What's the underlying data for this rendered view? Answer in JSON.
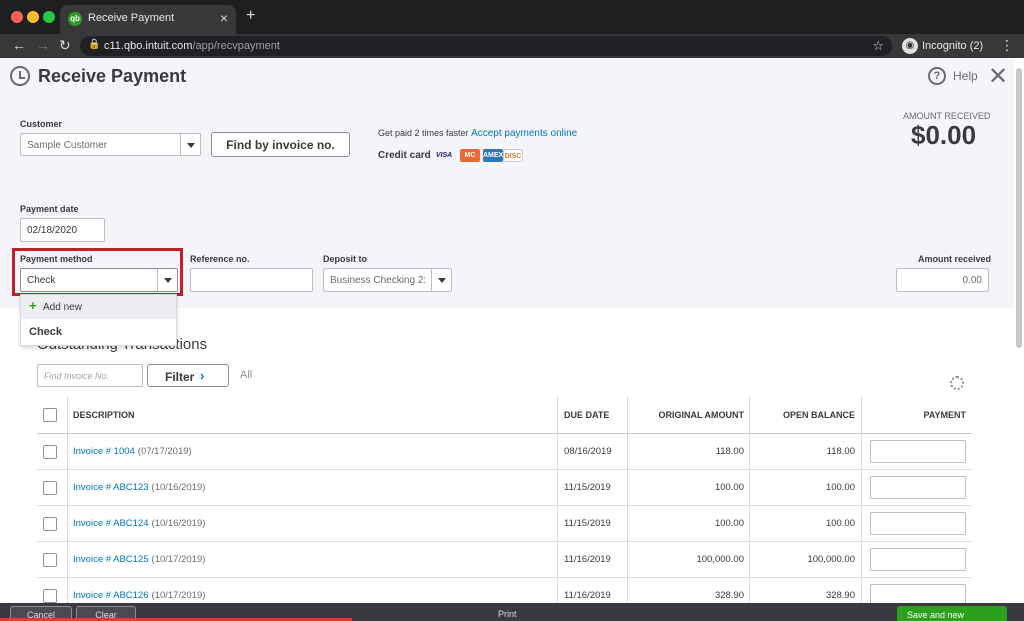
{
  "browser": {
    "tab_title": "Receive Payment",
    "tab_favicon": "qb",
    "url_host": "c11.qbo.intuit.com",
    "url_path": "/app/recvpayment",
    "profile_label": "Incognito (2)"
  },
  "header": {
    "title": "Receive Payment",
    "help_label": "Help"
  },
  "customer": {
    "label": "Customer",
    "value": "Sample Customer",
    "find_button": "Find by invoice no."
  },
  "promo": {
    "text": "Get paid 2 times faster",
    "link": "Accept payments online",
    "credit_card_label": "Credit card",
    "cards": [
      "VISA",
      "MC",
      "AMEX",
      "DISC"
    ]
  },
  "amount_received_summary": {
    "label": "AMOUNT RECEIVED",
    "value": "$0.00"
  },
  "payment_date": {
    "label": "Payment date",
    "value": "02/18/2020"
  },
  "payment_method": {
    "label": "Payment method",
    "value": "Check",
    "menu": {
      "add_new": "Add new",
      "options": [
        "Check"
      ]
    }
  },
  "reference": {
    "label": "Reference no.",
    "value": ""
  },
  "deposit_to": {
    "label": "Deposit to",
    "value": "Business Checking 2:"
  },
  "amount_received_field": {
    "label": "Amount received",
    "value": "0.00"
  },
  "outstanding": {
    "title": "Outstanding Transactions",
    "search_placeholder": "Find Invoice No.",
    "filter_label": "Filter",
    "all_label": "All",
    "columns": {
      "description": "DESCRIPTION",
      "due_date": "DUE DATE",
      "original_amount": "ORIGINAL AMOUNT",
      "open_balance": "OPEN BALANCE",
      "payment": "PAYMENT"
    },
    "rows": [
      {
        "invoice": "Invoice # 1004",
        "date": "(07/17/2019)",
        "due": "08/16/2019",
        "original": "118.00",
        "balance": "118.00"
      },
      {
        "invoice": "Invoice # ABC123",
        "date": "(10/16/2019)",
        "due": "11/15/2019",
        "original": "100.00",
        "balance": "100.00"
      },
      {
        "invoice": "Invoice # ABC124",
        "date": "(10/16/2019)",
        "due": "11/15/2019",
        "original": "100.00",
        "balance": "100.00"
      },
      {
        "invoice": "Invoice # ABC125",
        "date": "(10/17/2019)",
        "due": "11/16/2019",
        "original": "100,000.00",
        "balance": "100,000.00"
      },
      {
        "invoice": "Invoice # ABC126",
        "date": "(10/17/2019)",
        "due": "11/16/2019",
        "original": "328.90",
        "balance": "328.90"
      }
    ]
  },
  "footer": {
    "cancel": "Cancel",
    "clear": "Clear",
    "print": "Print",
    "save": "Save and new"
  }
}
